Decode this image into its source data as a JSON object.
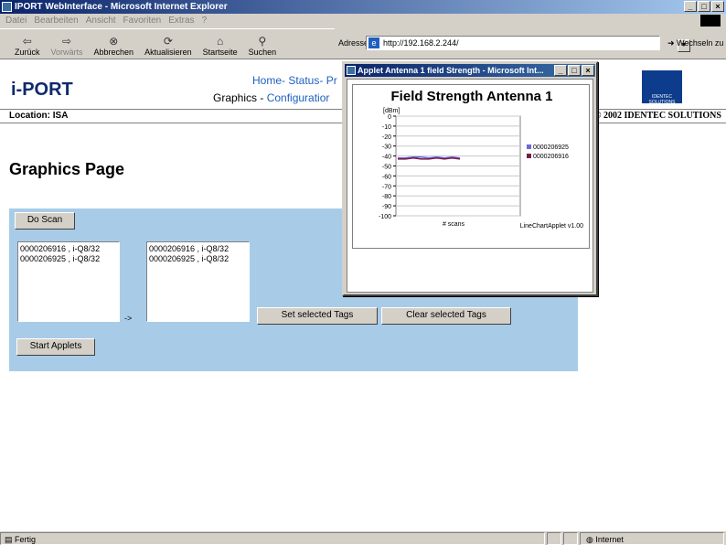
{
  "window": {
    "title": "IPORT WebInterface - Microsoft Internet Explorer"
  },
  "menu": [
    "Datei",
    "Bearbeiten",
    "Ansicht",
    "Favoriten",
    "Extras",
    "?"
  ],
  "toolbar": {
    "back": "Zurück",
    "forward": "Vorwärts",
    "stop": "Abbrechen",
    "refresh": "Aktualisieren",
    "home": "Startseite",
    "search": "Suchen"
  },
  "address": {
    "label": "Adresse",
    "url": "http://192.168.2.244/",
    "go": "Wechseln zu"
  },
  "header": {
    "logo": "i-PORT",
    "nav_line1": "Home- Status- Pr",
    "nav_graphics": "Graphics - ",
    "nav_config": "Configuratior",
    "identec_logo": "IDENTEC SOLUTIONS"
  },
  "location": {
    "label": "Location: ISA",
    "copyright": "© 2002 IDENTEC SOLUTIONS"
  },
  "page": {
    "title": "Graphics Page",
    "do_scan": "Do Scan",
    "left_list": [
      "0000206916 , i-Q8/32",
      "0000206925 , i-Q8/32"
    ],
    "right_list": [
      "0000206916 , i-Q8/32",
      "0000206925 , i-Q8/32"
    ],
    "arrow": "->",
    "set_tags": "Set selected Tags",
    "clear_tags": "Clear selected Tags",
    "start_applets": "Start Applets"
  },
  "status": {
    "left": "Fertig",
    "zone": "Internet"
  },
  "popup": {
    "title": "Applet Antenna 1 field Strength - Microsoft Int...",
    "footer": "LineChartApplet v1.00"
  },
  "chart_data": {
    "type": "line",
    "title": "Field Strength Antenna 1",
    "ylabel": "[dBm]",
    "xlabel": "# scans",
    "ylim": [
      -100,
      0
    ],
    "yticks": [
      0,
      -10,
      -20,
      -30,
      -40,
      -50,
      -60,
      -70,
      -80,
      -90,
      -100
    ],
    "series": [
      {
        "name": "0000206925",
        "color": "#6a6ad8",
        "values": [
          -42,
          -42,
          -41,
          -41,
          -42,
          -41,
          -42,
          -41,
          -42
        ]
      },
      {
        "name": "0000206916",
        "color": "#7a1a4a",
        "values": [
          -43,
          -43,
          -42,
          -43,
          -43,
          -42,
          -43,
          -42,
          -43
        ]
      }
    ],
    "grid": true,
    "legend": "right"
  }
}
